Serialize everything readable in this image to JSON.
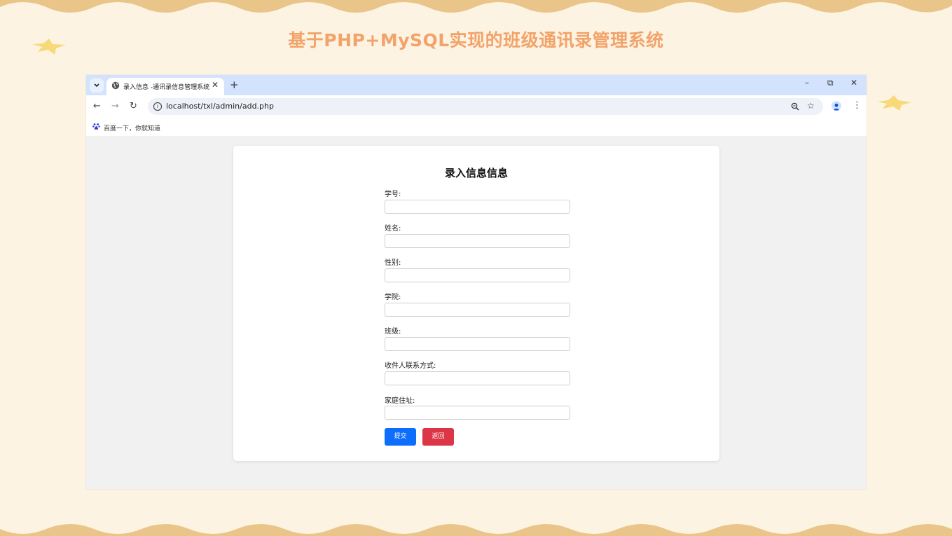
{
  "slide": {
    "title": "基于PHP+MySQL实现的班级通讯录管理系统"
  },
  "browser": {
    "tab_title": "录入信息 -通讯录信息管理系统",
    "url": "localhost/txl/admin/add.php",
    "bookmark_label": "百度一下，你就知道"
  },
  "form": {
    "title": "录入信息信息",
    "fields": [
      {
        "label": "学号:",
        "value": ""
      },
      {
        "label": "姓名:",
        "value": ""
      },
      {
        "label": "性别:",
        "value": ""
      },
      {
        "label": "学院:",
        "value": ""
      },
      {
        "label": "班级:",
        "value": ""
      },
      {
        "label": "收件人联系方式:",
        "value": ""
      },
      {
        "label": "家庭住址:",
        "value": ""
      }
    ],
    "submit_label": "提交",
    "back_label": "返回"
  },
  "colors": {
    "slide_bg": "#fdf3e2",
    "scallop": "#e9c58a",
    "title": "#f2a36a",
    "submit": "#0d6efd",
    "back": "#dc3545"
  }
}
